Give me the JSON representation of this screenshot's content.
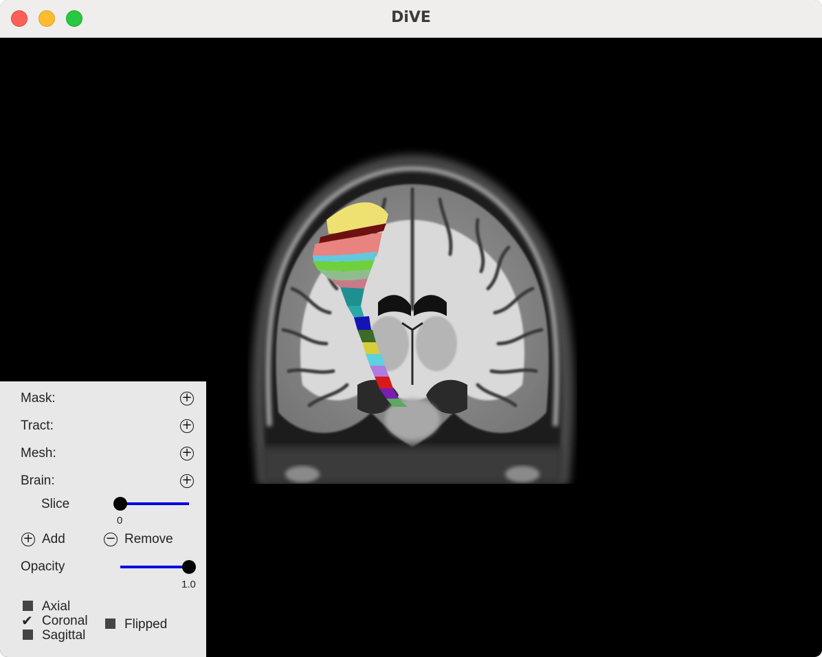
{
  "window": {
    "title": "DiVE"
  },
  "panel": {
    "rows": [
      {
        "label": "Mask:",
        "icon": "plus-circle-icon"
      },
      {
        "label": "Tract:",
        "icon": "plus-circle-icon"
      },
      {
        "label": "Mesh:",
        "icon": "plus-circle-icon"
      },
      {
        "label": "Brain:",
        "icon": "plus-circle-icon"
      }
    ],
    "slice": {
      "label": "Slice",
      "value": "0"
    },
    "add_label": "Add",
    "remove_label": "Remove",
    "opacity": {
      "label": "Opacity",
      "value": "1.0"
    },
    "views": [
      {
        "label": "Axial",
        "checked": false
      },
      {
        "label": "Coronal",
        "checked": true
      },
      {
        "label": "Sagittal",
        "checked": false
      }
    ],
    "flipped": {
      "label": "Flipped",
      "checked": false
    },
    "accent_color": "#0000e0"
  }
}
